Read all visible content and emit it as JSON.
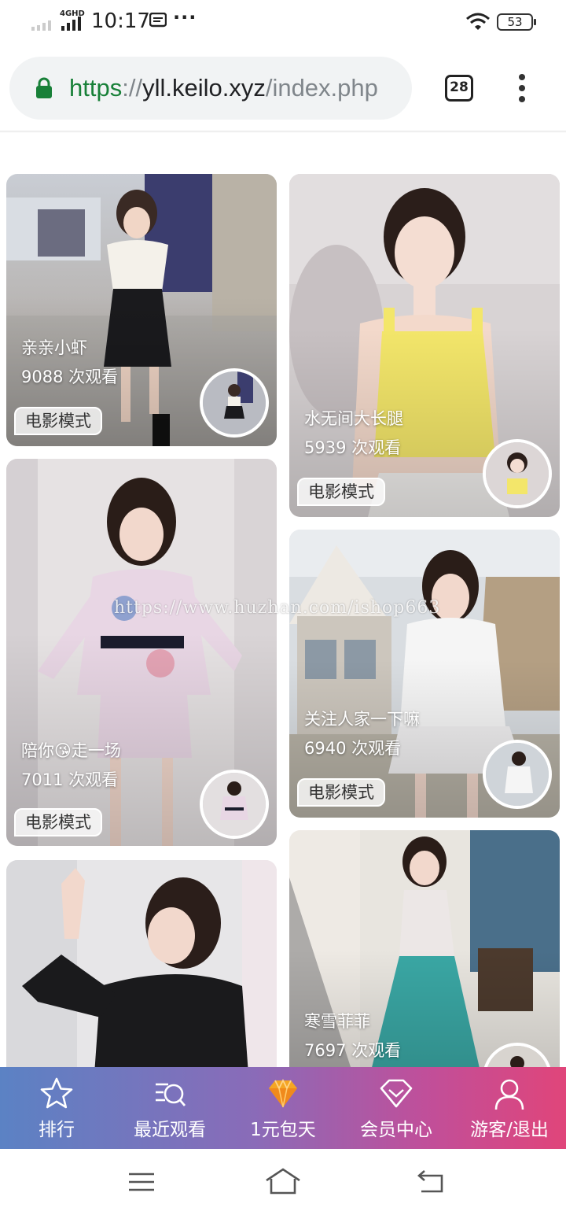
{
  "status_bar": {
    "network": "4GHD",
    "time": "10:17",
    "more": "···",
    "battery": "53",
    "icons": [
      "signal-icon",
      "message-icon",
      "wifi-icon",
      "battery-icon"
    ]
  },
  "browser": {
    "url_scheme": "https",
    "url_separator": "://",
    "url_host": "yll.keilo.xyz",
    "url_path": "/index.php",
    "tab_count": "28",
    "icons": [
      "lock-icon",
      "tabs-icon",
      "overflow-menu-icon"
    ],
    "colors": {
      "secure": "#188038"
    }
  },
  "watermark": "https://www.huzhan.com/ishop663",
  "cards": [
    {
      "title": "亲亲小虾",
      "views": "9088 次观看",
      "mode": "电影模式"
    },
    {
      "title": "水无间大长腿",
      "views": "5939 次观看",
      "mode": "电影模式"
    },
    {
      "title": "陪你😘走一场",
      "views": "7011 次观看",
      "mode": "电影模式"
    },
    {
      "title": "关注人家一下嘛",
      "views": "6940 次观看",
      "mode": "电影模式"
    },
    {
      "title": "寒雪菲菲",
      "views": "7697 次观看",
      "mode": ""
    },
    {
      "title": "",
      "views": "",
      "mode": ""
    }
  ],
  "tabbar": {
    "items": [
      {
        "label": "排行",
        "icon": "star-icon"
      },
      {
        "label": "最近观看",
        "icon": "recent-search-icon"
      },
      {
        "label": "1元包天",
        "icon": "diamond-gold-icon"
      },
      {
        "label": "会员中心",
        "icon": "diamond-outline-icon"
      },
      {
        "label": "游客/退出",
        "icon": "user-icon"
      }
    ],
    "colors": {
      "start": "#5b82c4",
      "end": "#e0457a",
      "diamond": "#f5a623"
    }
  },
  "navbar": {
    "icons": [
      "menu-icon",
      "home-icon",
      "back-icon"
    ]
  }
}
